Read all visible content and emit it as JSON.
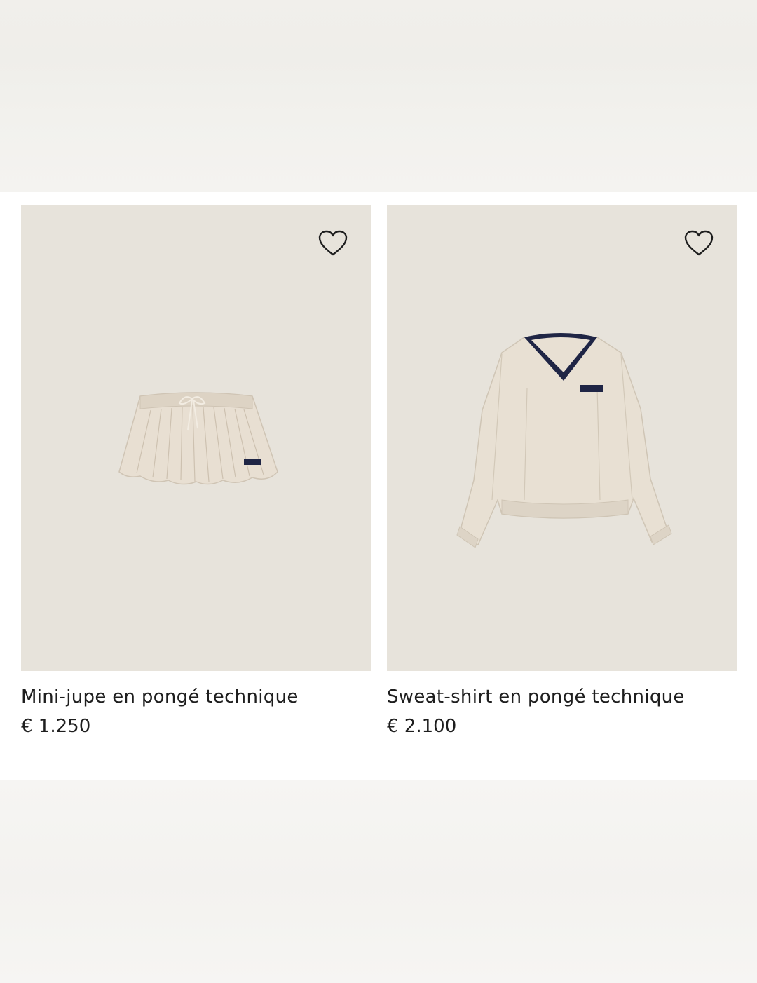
{
  "products": [
    {
      "title": "Mini-jupe en pongé technique",
      "price": "€ 1.250",
      "wishlist_icon": "heart-outline-icon",
      "image_subject": "pleated mini skirt"
    },
    {
      "title": "Sweat-shirt en pongé technique",
      "price": "€ 2.100",
      "wishlist_icon": "heart-outline-icon",
      "image_subject": "v-neck sweatshirt with navy trim"
    }
  ],
  "colors": {
    "image_background": "#e7e3db",
    "garment": "#e6ddd0",
    "trim": "#1f2545",
    "text": "#1e1e1e"
  }
}
